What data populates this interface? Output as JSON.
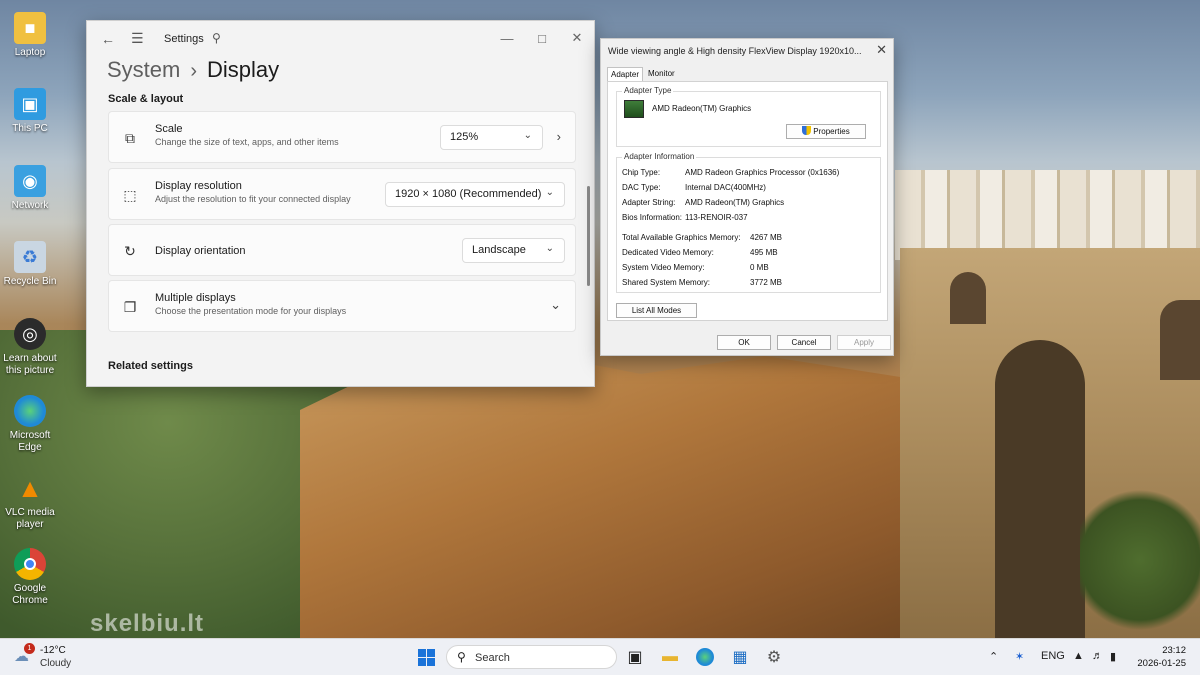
{
  "desktop": {
    "icons": [
      {
        "label": "Laptop",
        "icon": "folder-icon",
        "color": "#f0c040"
      },
      {
        "label": "This PC",
        "icon": "monitor-icon",
        "color": "#2f9be0"
      },
      {
        "label": "Network",
        "icon": "network-icon",
        "color": "#3aa0e0"
      },
      {
        "label": "Recycle Bin",
        "icon": "recycle-bin-icon",
        "color": "#c9d6e2"
      },
      {
        "label": "Learn about this picture",
        "icon": "camera-icon",
        "color": "#2b2b2b"
      },
      {
        "label": "Microsoft Edge",
        "icon": "edge-icon",
        "color": "#1f8ad6"
      },
      {
        "label": "VLC media player",
        "icon": "vlc-icon",
        "color": "#f08a00"
      },
      {
        "label": "Google Chrome",
        "icon": "chrome-icon",
        "color": "#db4437"
      }
    ],
    "watermark": "skelbiu.lt"
  },
  "settings": {
    "title": "Settings",
    "breadcrumb_parent": "System",
    "breadcrumb_sep": "›",
    "page_title": "Display",
    "section_title": "Scale & layout",
    "cards": {
      "scale": {
        "title": "Scale",
        "desc": "Change the size of text, apps, and other items",
        "value": "125%"
      },
      "resolution": {
        "title": "Display resolution",
        "desc": "Adjust the resolution to fit your connected display",
        "value": "1920 × 1080 (Recommended)"
      },
      "orientation": {
        "title": "Display orientation",
        "value": "Landscape"
      },
      "multiple": {
        "title": "Multiple displays",
        "desc": "Choose the presentation mode for your displays"
      }
    },
    "related_title": "Related settings"
  },
  "dialog": {
    "title": "Wide viewing angle & High density FlexView Display 1920x10...",
    "tabs": [
      "Adapter",
      "Monitor"
    ],
    "adapter_type_label": "Adapter Type",
    "adapter_name": "AMD Radeon(TM) Graphics",
    "properties_label": "Properties",
    "info_label": "Adapter Information",
    "info_rows": [
      {
        "key": "Chip Type:",
        "value": "AMD Radeon Graphics Processor (0x1636)"
      },
      {
        "key": "DAC Type:",
        "value": "Internal DAC(400MHz)"
      },
      {
        "key": "Adapter String:",
        "value": "AMD Radeon(TM) Graphics"
      },
      {
        "key": "Bios Information:",
        "value": "113-RENOIR-037"
      }
    ],
    "memory_rows": [
      {
        "key": "Total Available Graphics Memory:",
        "value": "4267 MB"
      },
      {
        "key": "Dedicated Video Memory:",
        "value": "495 MB"
      },
      {
        "key": "System Video Memory:",
        "value": "0 MB"
      },
      {
        "key": "Shared System Memory:",
        "value": "3772 MB"
      }
    ],
    "list_modes_label": "List All Modes",
    "ok_label": "OK",
    "cancel_label": "Cancel",
    "apply_label": "Apply"
  },
  "taskbar": {
    "weather_badge": "1",
    "temperature": "-12°C",
    "condition": "Cloudy",
    "search_placeholder": "Search",
    "language": "ENG",
    "time": "23:12",
    "date": "2026-01-25"
  }
}
